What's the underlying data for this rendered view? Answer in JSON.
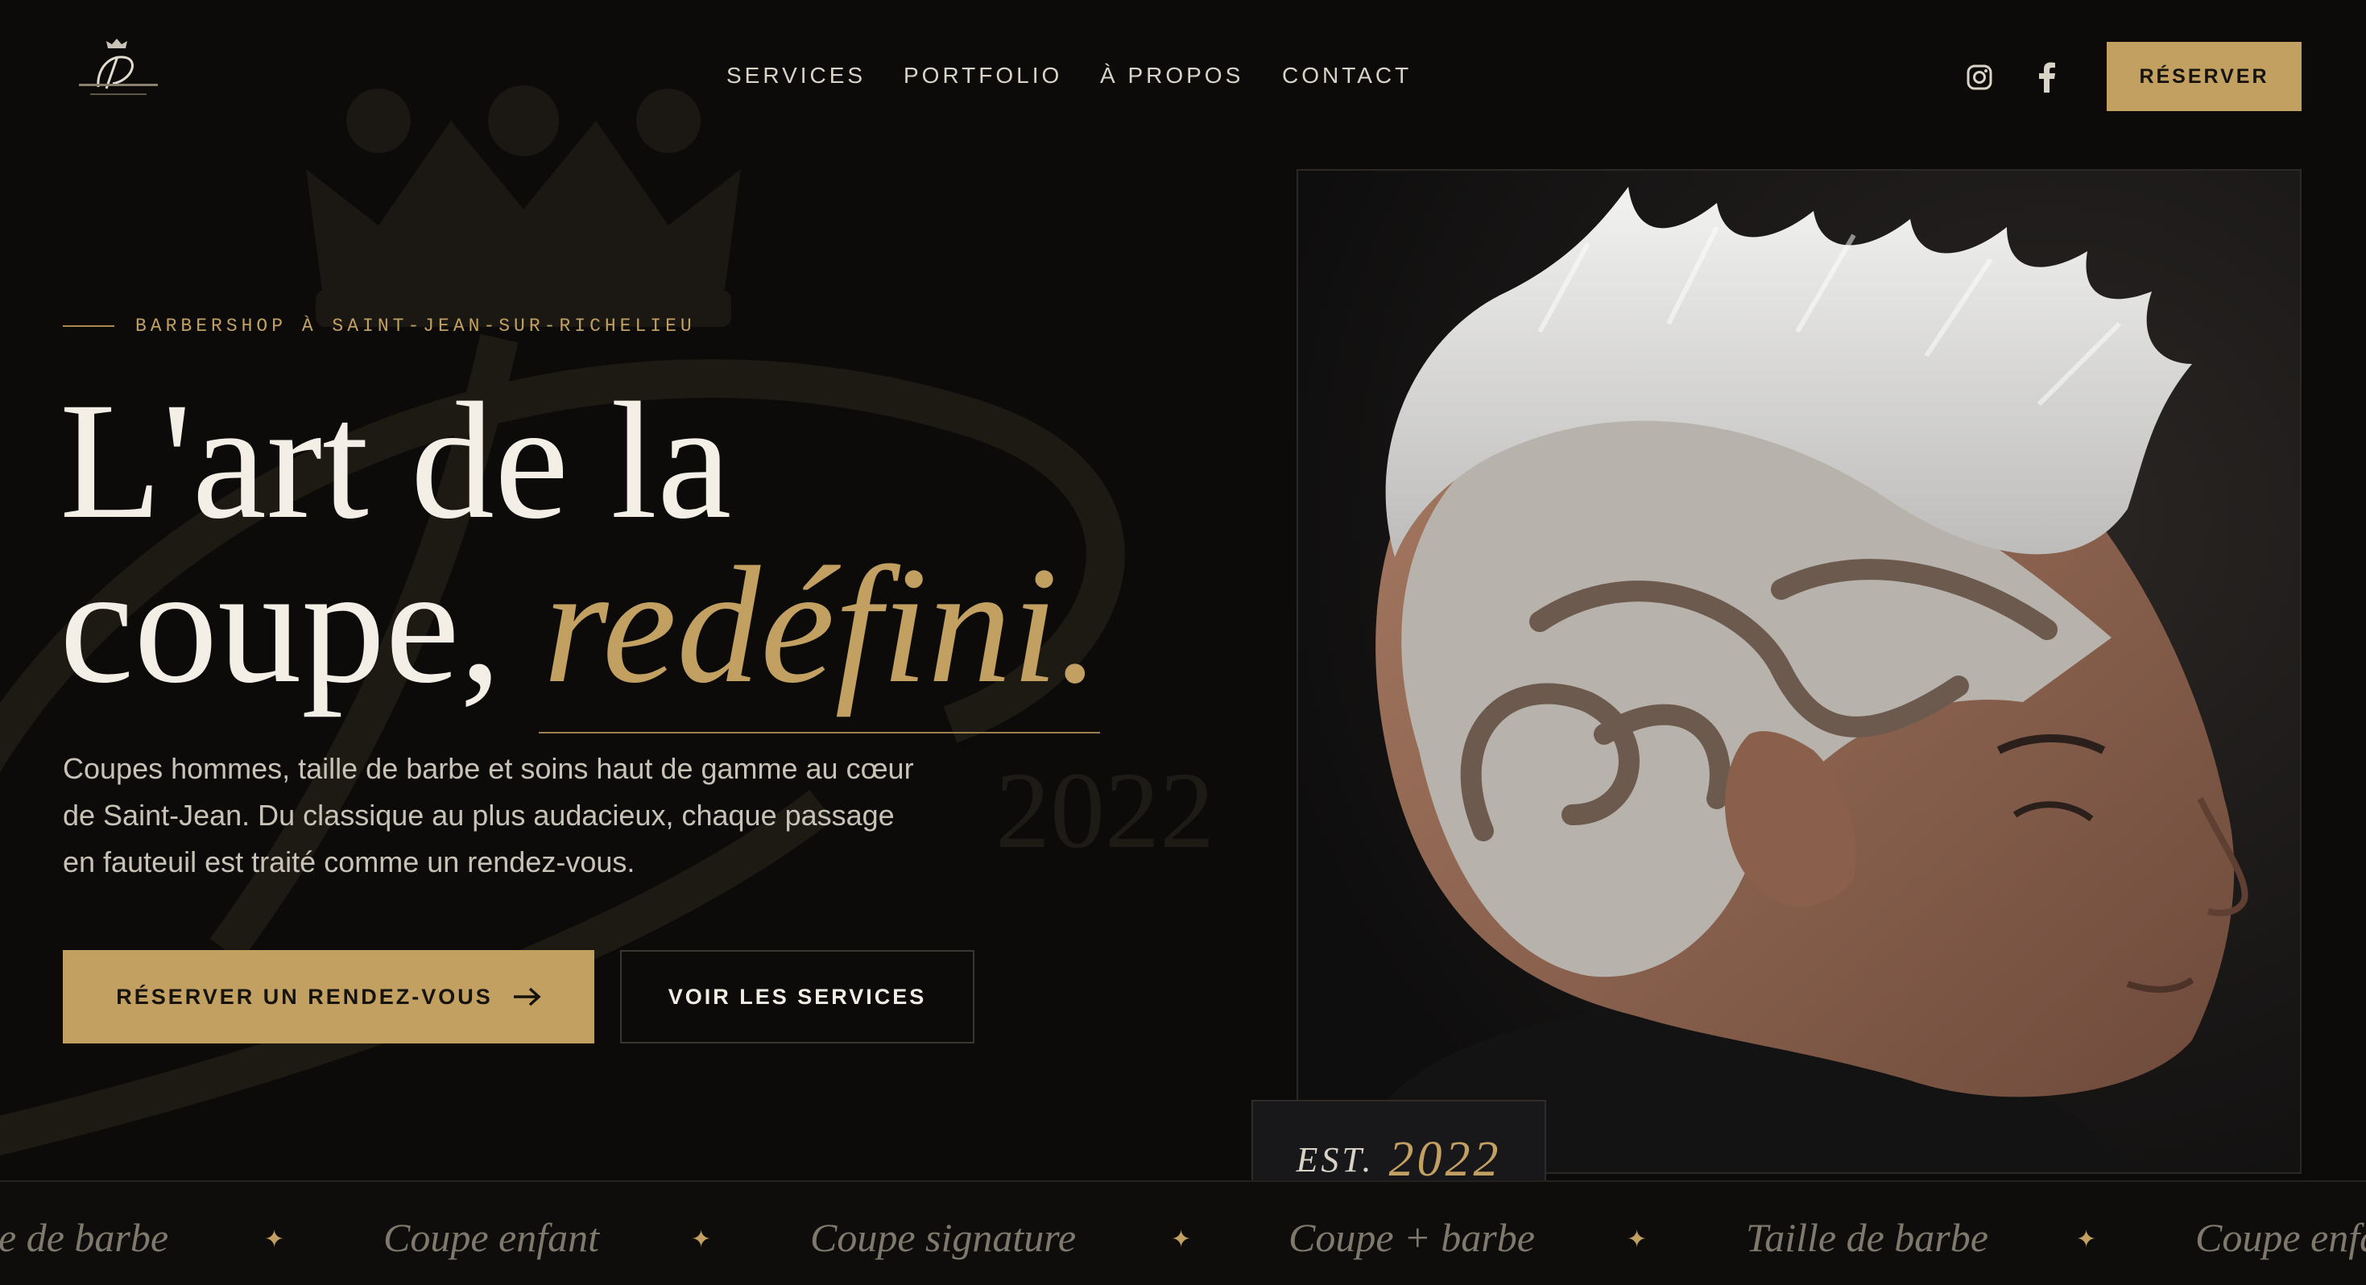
{
  "header": {
    "nav": [
      "SERVICES",
      "PORTFOLIO",
      "À PROPOS",
      "CONTACT"
    ],
    "reserve_label": "RÉSERVER",
    "social": [
      "instagram-icon",
      "facebook-icon"
    ]
  },
  "hero": {
    "eyebrow": "BARBERSHOP À SAINT-JEAN-SUR-RICHELIEU",
    "headline_line1": "L'art de la",
    "headline_line2_plain": "coupe, ",
    "headline_line2_accent": "redéfini.",
    "lede": "Coupes hommes, taille de barbe et soins haut de gamme au cœur de Saint-Jean. Du classique au plus audacieux, chaque passage en fauteuil est traité comme un rendez-vous.",
    "primary_cta": "RÉSERVER UN RENDEZ-VOUS",
    "secondary_cta": "VOIR LES SERVICES",
    "badge_est": "EST.",
    "badge_year": "2022",
    "watermark_year": "2022"
  },
  "marquee": {
    "items": [
      "e de barbe",
      "Coupe enfant",
      "Coupe signature",
      "Coupe + barbe",
      "Taille de barbe",
      "Coupe enfa"
    ]
  },
  "colors": {
    "background": "#0c0b0a",
    "gold": "#c2a062",
    "text": "#efe9df",
    "muted": "#c9c2b6"
  }
}
